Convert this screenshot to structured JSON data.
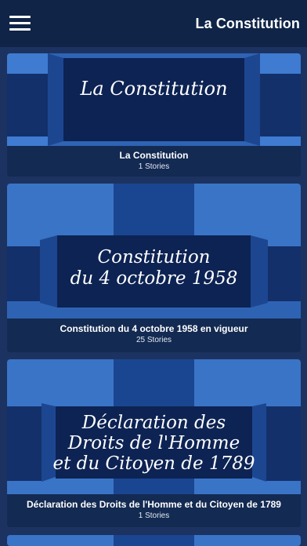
{
  "appbar": {
    "title": "La Constitution",
    "menu_icon": "hamburger-menu-icon"
  },
  "cards": [
    {
      "banner_lines": [
        "La Constitution"
      ],
      "title": "La Constitution",
      "count": "1 Stories"
    },
    {
      "banner_lines": [
        "Constitution",
        "du 4 octobre 1958"
      ],
      "title": "Constitution du 4 octobre 1958 en vigueur",
      "count": "25 Stories"
    },
    {
      "banner_lines": [
        "Déclaration des",
        "Droits de l'Homme",
        "et du Citoyen de 1789"
      ],
      "title": "Déclaration des Droits de l'Homme et du Citoyen de 1789",
      "count": "1 Stories"
    }
  ],
  "colors": {
    "appbar": "#0f2447",
    "panel_light": "#3c77c9",
    "panel_dark": "#12306a",
    "panel_center": "#0d2353",
    "caption_bg": "#132a52"
  }
}
